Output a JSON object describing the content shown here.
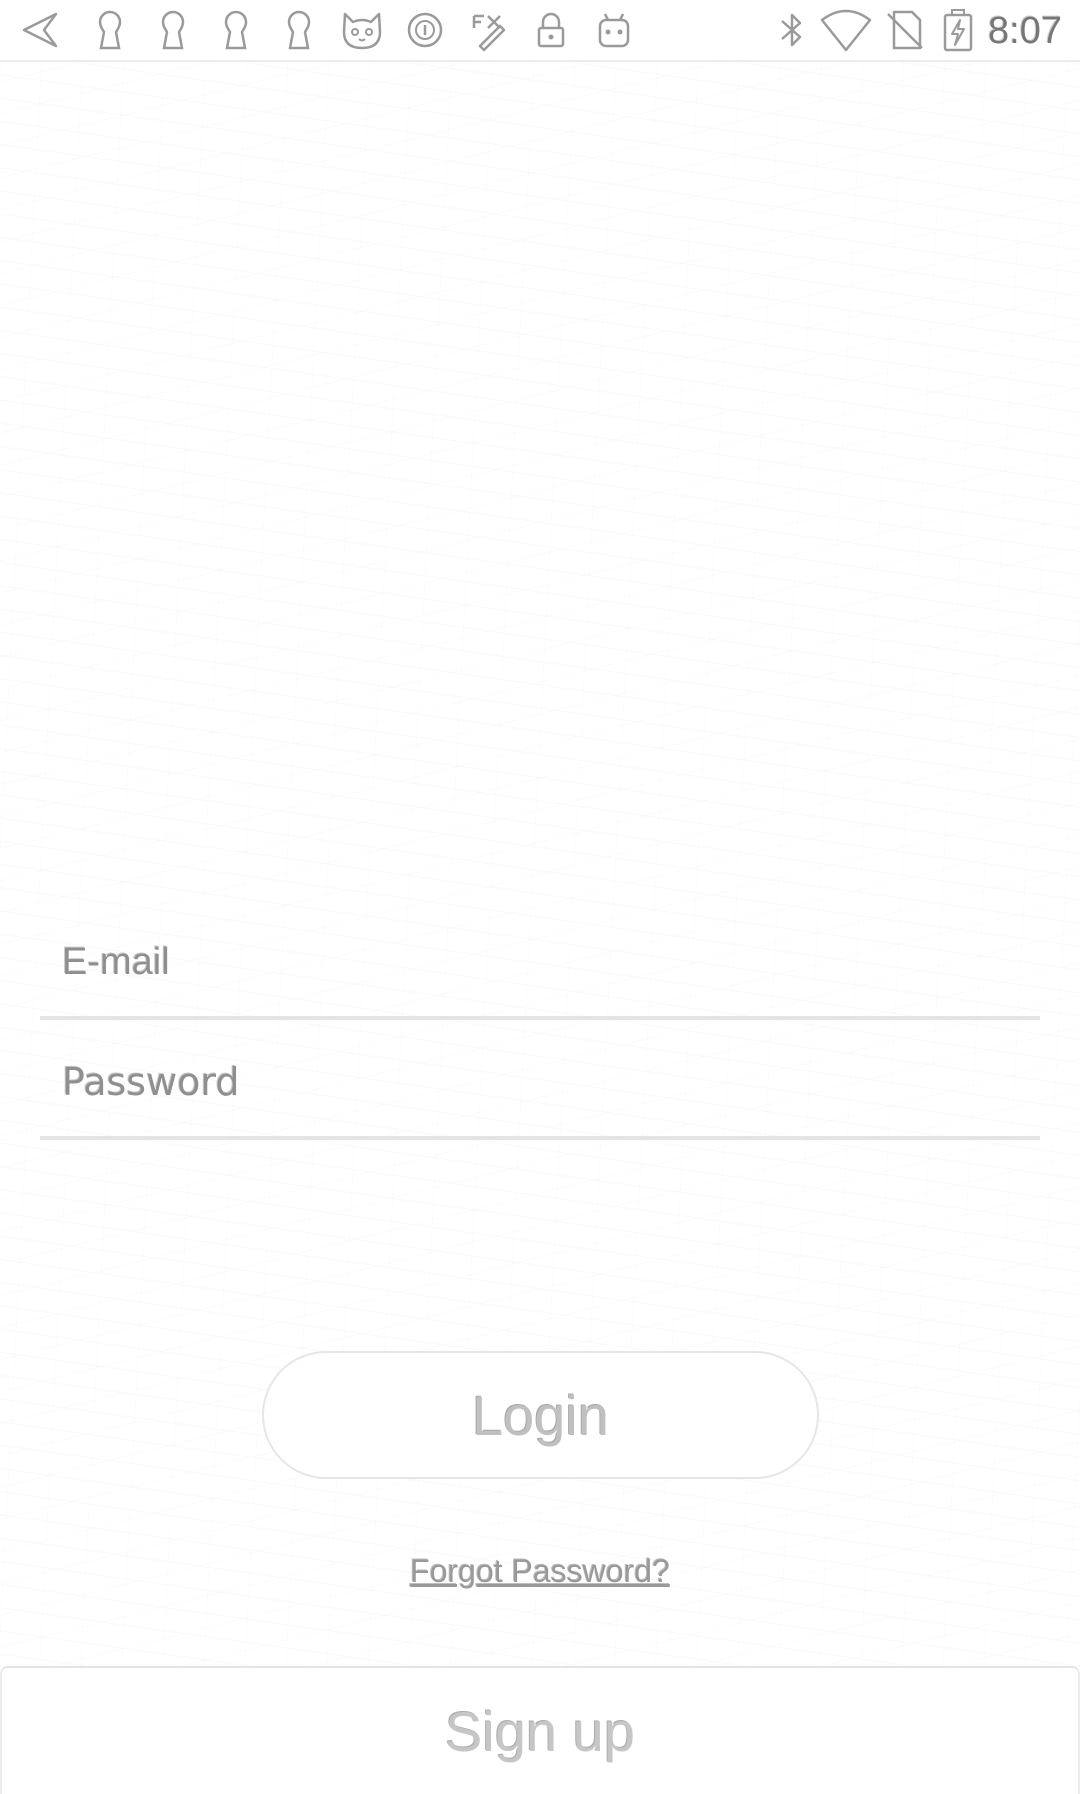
{
  "status_bar": {
    "time": "8:07",
    "left_icons": [
      "back-arrow-icon",
      "keyhole-icon",
      "keyhole-icon",
      "keyhole-icon",
      "keyhole-icon",
      "cat-face-icon",
      "circle-badge-icon",
      "fix-tool-icon",
      "lock-icon",
      "android-icon"
    ],
    "right_icons": [
      "bluetooth-icon",
      "wifi-icon",
      "no-sim-icon",
      "battery-charging-icon"
    ]
  },
  "login_form": {
    "email_placeholder": "E-mail",
    "email_value": "",
    "password_placeholder": "Password",
    "password_value": ""
  },
  "login_button_label": "Login",
  "forgot_password_label": "Forgot Password?",
  "signup_button_label": "Sign up"
}
